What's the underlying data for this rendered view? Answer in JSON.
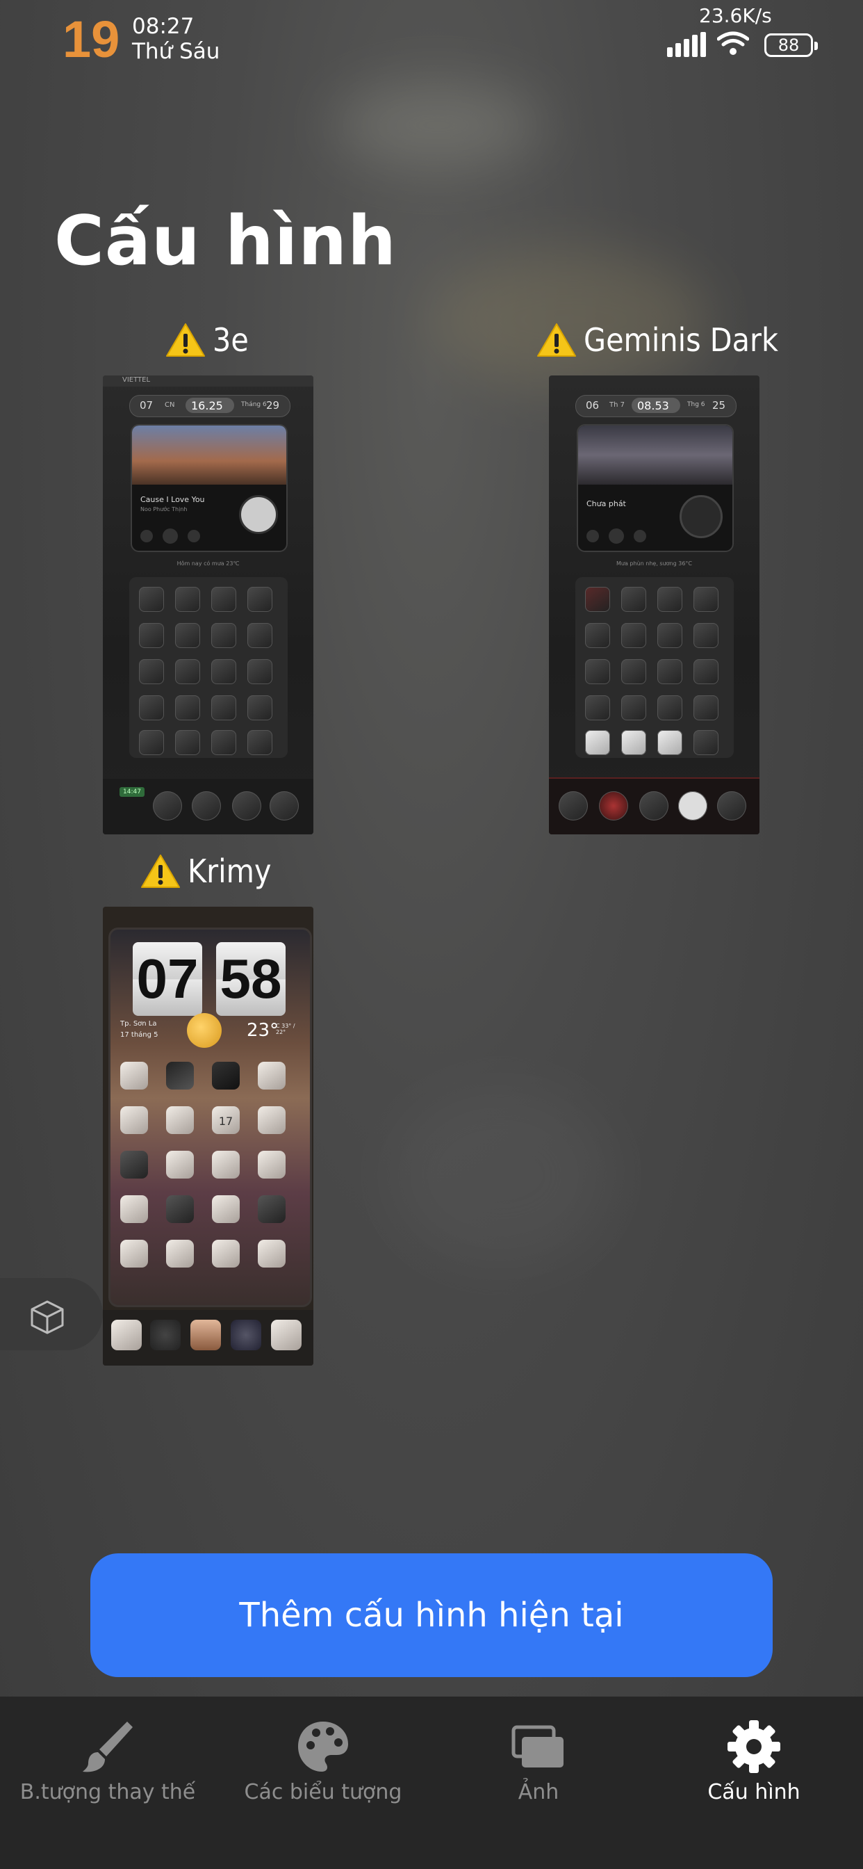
{
  "status_bar": {
    "day": "19",
    "time": "08:27",
    "weekday": "Thứ Sáu",
    "net_speed": "23.6K/s",
    "battery": "88"
  },
  "page": {
    "title": "Cấu hình"
  },
  "themes": [
    {
      "name": "3e",
      "warning": true,
      "preview": {
        "carrier": "VIETTEL",
        "clock": [
          "07",
          "CN",
          "16.25",
          "Tháng 6",
          "29"
        ],
        "song": "Cause I Love You",
        "artist": "Noo Phước Thịnh",
        "caption": "Hôm nay có mưa 23℃",
        "dock_badge": "14:47"
      }
    },
    {
      "name": "Geminis Dark",
      "warning": true,
      "preview": {
        "clock": [
          "06",
          "Th 7",
          "08.53",
          "Thg 6",
          "25"
        ],
        "media_status": "Chưa phát",
        "caption": "Mưa phùn nhẹ, sương 36°C"
      }
    },
    {
      "name": "Krimy",
      "warning": true,
      "preview": {
        "hour": "07",
        "minute": "58",
        "location": "Tp. Sơn La",
        "date": "17 tháng 5",
        "temperature": "23°",
        "temp_range": "C 33° / 22°",
        "calendar_day": "17"
      }
    }
  ],
  "actions": {
    "add_current": "Thêm cấu hình hiện tại"
  },
  "bottom_nav": {
    "items": [
      {
        "label": "B.tượng thay thế",
        "icon": "brush-icon",
        "active": false
      },
      {
        "label": "Các biểu tượng",
        "icon": "palette-icon",
        "active": false
      },
      {
        "label": "Ảnh",
        "icon": "images-icon",
        "active": false
      },
      {
        "label": "Cấu hình",
        "icon": "gear-icon",
        "active": true
      }
    ]
  },
  "colors": {
    "accent": "#3478f6",
    "day_number": "#e8923a",
    "nav_active": "#ffffff",
    "nav_inactive": "#8e8e8e",
    "warning": "#f5c518"
  }
}
